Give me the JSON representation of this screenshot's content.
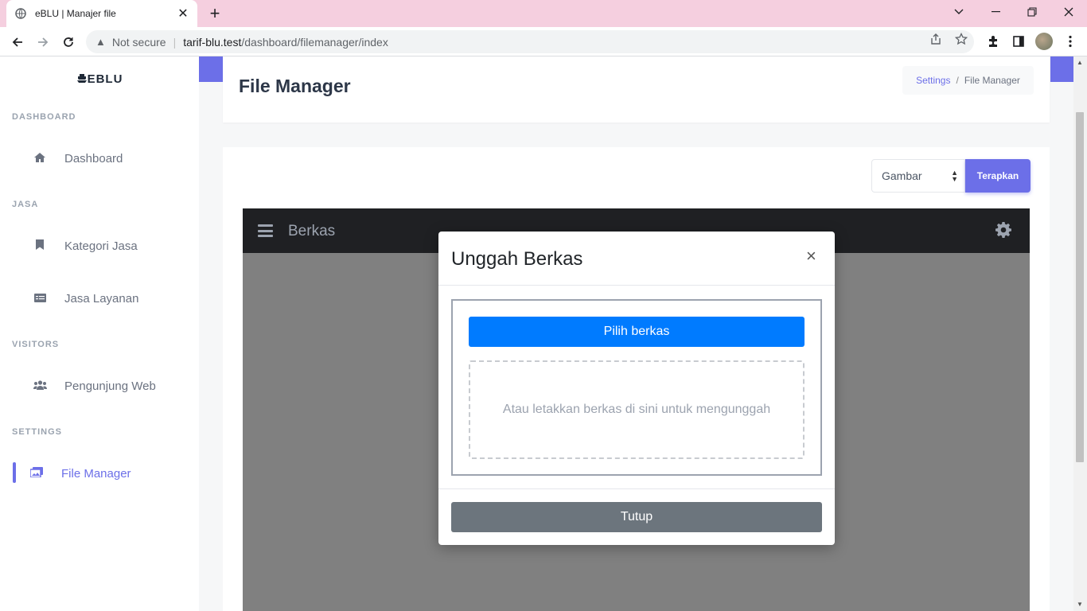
{
  "browser": {
    "tab_title": "eBLU | Manajer file",
    "tab_close": "✕",
    "new_tab": "+",
    "not_secure": "Not secure",
    "url_host": "tarif-blu.test",
    "url_path": "/dashboard/filemanager/index"
  },
  "sidebar": {
    "brand": "EBLU",
    "sections": {
      "dashboard": "DASHBOARD",
      "jasa": "JASA",
      "visitors": "VISITORS",
      "settings": "SETTINGS"
    },
    "items": [
      {
        "label": "Dashboard",
        "icon": "home-icon"
      },
      {
        "label": "Kategori Jasa",
        "icon": "bookmark-icon"
      },
      {
        "label": "Jasa Layanan",
        "icon": "list-card-icon"
      },
      {
        "label": "Pengunjung Web",
        "icon": "users-icon"
      },
      {
        "label": "File Manager",
        "icon": "images-icon",
        "active": true
      }
    ]
  },
  "header": {
    "title": "File Manager",
    "breadcrumb": {
      "parent": "Settings",
      "separator": "/",
      "current": "File Manager"
    }
  },
  "filter": {
    "selected": "Gambar",
    "apply_label": "Terapkan"
  },
  "filemanager": {
    "title": "Berkas"
  },
  "modal": {
    "title": "Unggah Berkas",
    "close_symbol": "×",
    "pick_label": "Pilih berkas",
    "drop_text": "Atau letakkan berkas di sini untuk mengunggah",
    "close_label": "Tutup"
  },
  "colors": {
    "accent": "#6c6fe8",
    "primary_button": "#007bff",
    "secondary_button": "#6c757d",
    "tab_strip": "#f5cfdf"
  }
}
